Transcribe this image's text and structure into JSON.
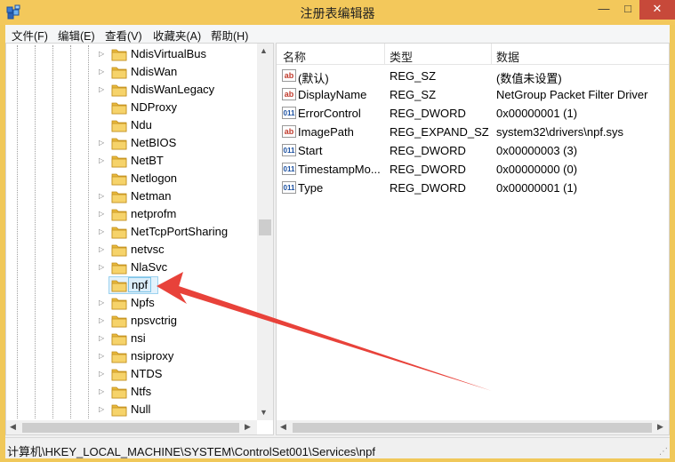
{
  "window": {
    "title": "注册表编辑器",
    "minimize_glyph": "—",
    "maximize_glyph": "□",
    "close_glyph": "✕"
  },
  "menu": [
    "文件(F)",
    "编辑(E)",
    "查看(V)",
    "收藏夹(A)",
    "帮助(H)"
  ],
  "tree": {
    "items": [
      {
        "label": "NdisVirtualBus",
        "expandable": true
      },
      {
        "label": "NdisWan",
        "expandable": true
      },
      {
        "label": "NdisWanLegacy",
        "expandable": true
      },
      {
        "label": "NDProxy",
        "expandable": false
      },
      {
        "label": "Ndu",
        "expandable": false
      },
      {
        "label": "NetBIOS",
        "expandable": true
      },
      {
        "label": "NetBT",
        "expandable": true
      },
      {
        "label": "Netlogon",
        "expandable": false
      },
      {
        "label": "Netman",
        "expandable": true
      },
      {
        "label": "netprofm",
        "expandable": true
      },
      {
        "label": "NetTcpPortSharing",
        "expandable": true
      },
      {
        "label": "netvsc",
        "expandable": true
      },
      {
        "label": "NlaSvc",
        "expandable": true
      },
      {
        "label": "npf",
        "expandable": false,
        "selected": true
      },
      {
        "label": "Npfs",
        "expandable": true
      },
      {
        "label": "npsvctrig",
        "expandable": true
      },
      {
        "label": "nsi",
        "expandable": true
      },
      {
        "label": "nsiproxy",
        "expandable": true
      },
      {
        "label": "NTDS",
        "expandable": true
      },
      {
        "label": "Ntfs",
        "expandable": true
      },
      {
        "label": "Null",
        "expandable": true
      }
    ]
  },
  "list": {
    "headers": {
      "name": "名称",
      "type": "类型",
      "data": "数据"
    },
    "rows": [
      {
        "icon": "string-value-icon",
        "name": "(默认)",
        "type": "REG_SZ",
        "data": "(数值未设置)"
      },
      {
        "icon": "string-value-icon",
        "name": "DisplayName",
        "type": "REG_SZ",
        "data": "NetGroup Packet Filter Driver"
      },
      {
        "icon": "dword-value-icon",
        "name": "ErrorControl",
        "type": "REG_DWORD",
        "data": "0x00000001 (1)"
      },
      {
        "icon": "string-value-icon",
        "name": "ImagePath",
        "type": "REG_EXPAND_SZ",
        "data": "system32\\drivers\\npf.sys"
      },
      {
        "icon": "dword-value-icon",
        "name": "Start",
        "type": "REG_DWORD",
        "data": "0x00000003 (3)"
      },
      {
        "icon": "dword-value-icon",
        "name": "TimestampMo...",
        "type": "REG_DWORD",
        "data": "0x00000000 (0)"
      },
      {
        "icon": "dword-value-icon",
        "name": "Type",
        "type": "REG_DWORD",
        "data": "0x00000001 (1)"
      }
    ]
  },
  "status": {
    "path": "计算机\\HKEY_LOCAL_MACHINE\\SYSTEM\\ControlSet001\\Services\\npf"
  },
  "icons": {
    "string_glyph": "ab",
    "dword_glyph": "011",
    "expander": "▷"
  },
  "colors": {
    "title_bar": "#f3c85b",
    "close_button": "#c7493a",
    "annotation_arrow": "#e8423a",
    "selection": "#dbeefb"
  }
}
